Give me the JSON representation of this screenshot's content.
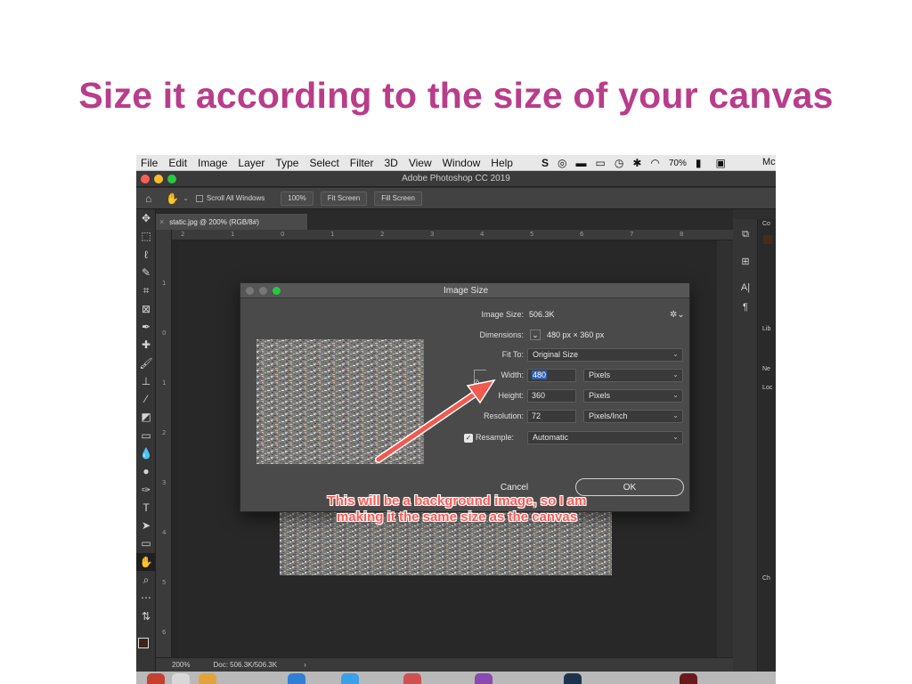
{
  "slide": {
    "title": "Size it according to the size of your canvas"
  },
  "menubar": {
    "items": [
      "File",
      "Edit",
      "Image",
      "Layer",
      "Type",
      "Select",
      "Filter",
      "3D",
      "View",
      "Window",
      "Help"
    ],
    "battery": "70%",
    "clip": "Mc"
  },
  "window": {
    "title": "Adobe Photoshop CC 2019"
  },
  "options_bar": {
    "scroll_all": "Scroll All Windows",
    "zoom_btn": "100%",
    "fit_btn": "Fit Screen",
    "fill_btn": "Fill Screen"
  },
  "document": {
    "tab": "static.jpg @ 200% (RGB/8#)",
    "hruler": [
      "2",
      "1",
      "0",
      "1",
      "2",
      "3",
      "4",
      "5",
      "6",
      "7",
      "8"
    ],
    "vruler": [
      "1",
      "0",
      "1",
      "2",
      "3",
      "4",
      "5",
      "6"
    ]
  },
  "status": {
    "zoom": "200%",
    "doc": "Doc: 506.3K/506.3K",
    "arrow": "›"
  },
  "right_panel": {
    "labels": [
      "Co",
      "Lib",
      "Ne",
      "Loc",
      "Ch"
    ]
  },
  "dialog": {
    "title": "Image Size",
    "image_size_label": "Image Size:",
    "image_size_value": "506.3K",
    "dimensions_label": "Dimensions:",
    "dimensions_value": "480 px  ×  360 px",
    "fit_to_label": "Fit To:",
    "fit_to_value": "Original Size",
    "width_label": "Width:",
    "width_value": "480",
    "width_unit": "Pixels",
    "height_label": "Height:",
    "height_value": "360",
    "height_unit": "Pixels",
    "resolution_label": "Resolution:",
    "resolution_value": "72",
    "resolution_unit": "Pixels/Inch",
    "resample_label": "Resample:",
    "resample_value": "Automatic",
    "cancel": "Cancel",
    "ok": "OK"
  },
  "annotation": {
    "line1": "This will be a background image, so I am",
    "line2": "making it the same size as the canvas"
  },
  "colors": {
    "title": "#b83d8a",
    "annotation": "#ff5a55",
    "highlight": "#2f5fb3"
  },
  "icons": [
    "home-icon",
    "hand-icon",
    "gear-icon",
    "link-icon",
    "checkbox-icon",
    "wifi-icon",
    "battery-icon",
    "bluetooth-icon",
    "time-machine-icon"
  ]
}
